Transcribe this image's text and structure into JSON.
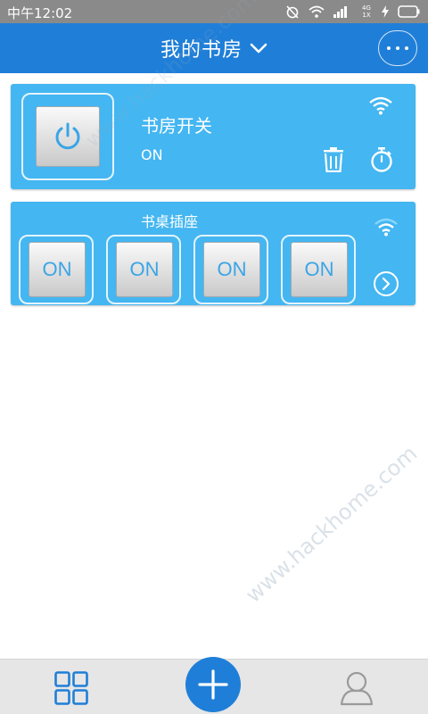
{
  "status_bar": {
    "time": "中午12:02",
    "network": "4G 1X"
  },
  "header": {
    "title": "我的书房"
  },
  "devices": [
    {
      "name": "书房开关",
      "state": "ON"
    },
    {
      "name": "书桌插座",
      "outlets": [
        {
          "label": "ON"
        },
        {
          "label": "ON"
        },
        {
          "label": "ON"
        },
        {
          "label": "ON"
        }
      ]
    }
  ],
  "watermark": {
    "text": "www.hackhome.com"
  },
  "colors": {
    "primary": "#1f7fd8",
    "card": "#44b6f1",
    "on_text": "#3aa5e6"
  }
}
